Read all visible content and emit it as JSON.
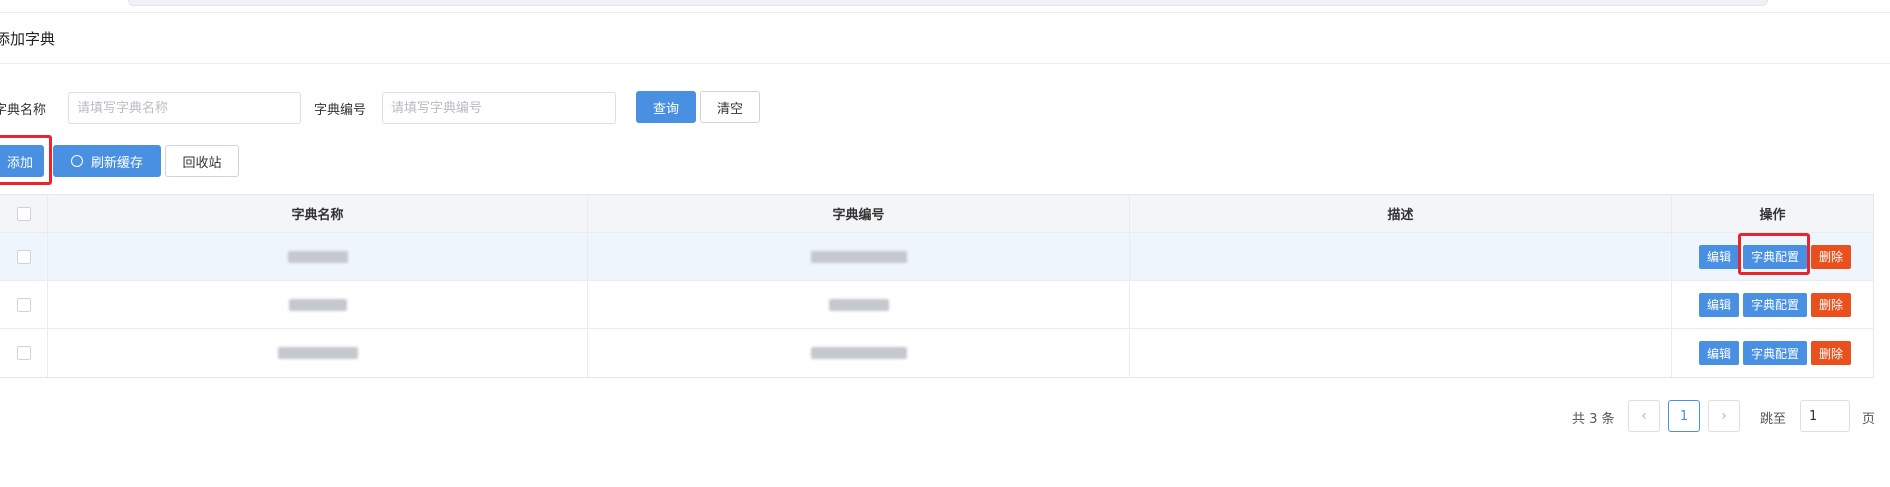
{
  "header": {
    "title": "添加字典"
  },
  "search": {
    "name_label": "字典名称",
    "name_placeholder": "请填写字典名称",
    "code_label": "字典编号",
    "code_placeholder": "请填写字典编号",
    "query_label": "查询",
    "clear_label": "清空"
  },
  "toolbar": {
    "add_label": "添加",
    "refresh_label": "刷新缓存",
    "refresh_icon": "circle-icon",
    "recycle_label": "回收站"
  },
  "table": {
    "columns": [
      "字典名称",
      "字典编号",
      "描述",
      "操作"
    ],
    "actions": {
      "edit": "编辑",
      "config": "字典配置",
      "delete": "删除"
    }
  },
  "pagination": {
    "total_text": "共 3 条",
    "prev_icon": "‹",
    "current_page": "1",
    "next_icon": "›",
    "goto_label": "跳至",
    "goto_value": "1",
    "page_suffix": "页"
  },
  "colors": {
    "primary": "#4a90e2",
    "danger": "#e8501e",
    "highlight": "#e8252c"
  }
}
